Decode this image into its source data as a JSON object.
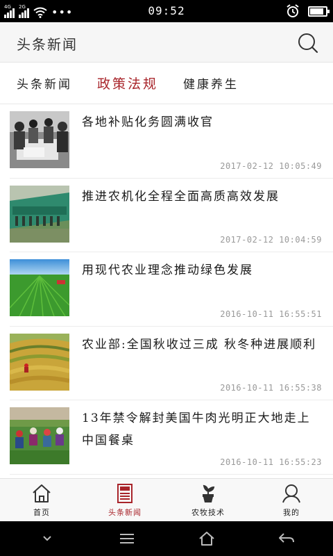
{
  "status_bar": {
    "network_1": "4G",
    "network_2": "2G",
    "more": "•••",
    "time": "09:52",
    "battery_level": 0.85
  },
  "header": {
    "title": "头条新闻",
    "search_icon": "search-icon"
  },
  "tabs": [
    {
      "label": "头条新闻",
      "active": false
    },
    {
      "label": "政策法规",
      "active": true
    },
    {
      "label": "健康养生",
      "active": false
    }
  ],
  "news": [
    {
      "title": "各地补贴化务圆满收官",
      "date": "2017-02-12  10:05:49",
      "thumb": "people-meeting-photo"
    },
    {
      "title": "推进农机化全程全面高质高效发展",
      "date": "2017-02-12  10:04:59",
      "thumb": "farm-machinery-photo"
    },
    {
      "title": "用现代农业理念推动绿色发展",
      "date": "2016-10-11  16:55:51",
      "thumb": "green-field-photo"
    },
    {
      "title": "农业部:全国秋收过三成  秋冬种进展顺利",
      "date": "2016-10-11  16:55:38",
      "thumb": "rice-terrace-photo"
    },
    {
      "title": "13年禁令解封美国牛肉光明正大地走上中国餐桌",
      "date": "2016-10-11  16:55:23",
      "thumb": "farmers-field-photo"
    }
  ],
  "bottom_nav": [
    {
      "label": "首页",
      "icon": "home-icon",
      "active": false
    },
    {
      "label": "头条新闻",
      "icon": "newspaper-icon",
      "active": true
    },
    {
      "label": "农牧技术",
      "icon": "plant-pot-icon",
      "active": false
    },
    {
      "label": "我的",
      "icon": "user-icon",
      "active": false
    }
  ],
  "colors": {
    "accent": "#a8242a",
    "text": "#1a1a1a",
    "date": "#999999"
  }
}
